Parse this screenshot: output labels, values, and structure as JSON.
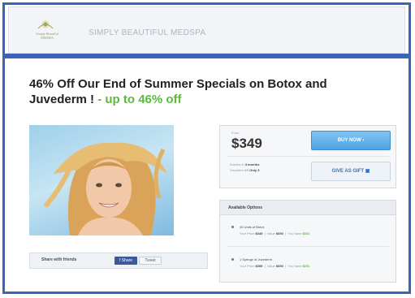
{
  "header": {
    "brand": "SIMPLY BEAUTIFUL MEDSPA",
    "logo_text": "Simply Beautiful",
    "logo_subtext": "MEDSPA"
  },
  "deal": {
    "title_main": "46% Off Our End of Summer Specials on Botox and Juvederm !",
    "title_accent": " - up to 46% off"
  },
  "pricing": {
    "from_label": "From",
    "price": "$349",
    "buy_label": "BUY NOW ›",
    "gift_label": "GIVE AS GIFT",
    "expires_label": "Expires in",
    "expires_value": "3 months",
    "vouchers_label": "Vouchers left",
    "vouchers_value": "Only 3"
  },
  "options": {
    "heading": "Available Options",
    "items": [
      {
        "name": "40 Units of Botox",
        "your_price_label": "Your Price",
        "your_price": "$349",
        "value_label": "Value",
        "value": "$650",
        "save_label": "You Save",
        "save": "$301"
      },
      {
        "name": "1 Syringe of Juvederm",
        "your_price_label": "Your Price",
        "your_price": "$399",
        "value_label": "Value",
        "value": "$650",
        "save_label": "You Save",
        "save": "$251"
      }
    ]
  },
  "share": {
    "label": "Share with friends",
    "facebook": "f Share",
    "twitter": "Tweet"
  },
  "colors": {
    "frame_blue": "#3b63b8",
    "accent_green": "#5aba3c",
    "buy_blue": "#4fa3e3"
  }
}
